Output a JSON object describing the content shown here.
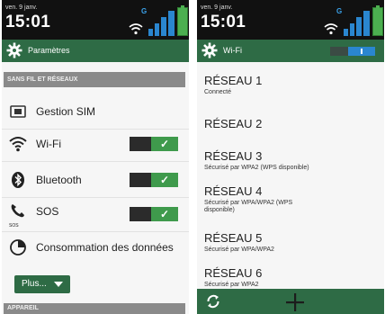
{
  "left": {
    "status": {
      "date": "ven. 9 janv.",
      "time": "15:01",
      "network_type": "G"
    },
    "header": {
      "title": "Paramètres"
    },
    "section_wireless": "SANS FIL ET RÉSEAUX",
    "items": [
      {
        "label": "Gestion SIM",
        "icon": "sim-card-icon"
      },
      {
        "label": "Wi-Fi",
        "icon": "wifi-icon",
        "toggle": true
      },
      {
        "label": "Bluetooth",
        "icon": "bluetooth-icon",
        "toggle": true
      },
      {
        "label": "SOS",
        "icon": "sos-phone-icon",
        "toggle": true,
        "sub": "SOS"
      },
      {
        "label": "Consommation des données",
        "icon": "data-usage-icon"
      }
    ],
    "more_button": "Plus...",
    "section_device": "APPAREIL"
  },
  "right": {
    "status": {
      "date": "ven. 9 janv.",
      "time": "15:01",
      "network_type": "G"
    },
    "header": {
      "title": "Wi-Fi",
      "toggle": true
    },
    "networks": [
      {
        "name": "RÉSEAU 1",
        "status": "Connecté"
      },
      {
        "name": "RÉSEAU 2",
        "status": ""
      },
      {
        "name": "RÉSEAU 3",
        "status": "Sécurisé par WPA2 (WPS disponible)"
      },
      {
        "name": "RÉSEAU 4",
        "status": "Sécurisé par WPA/WPA2 (WPS disponible)"
      },
      {
        "name": "RÉSEAU 5",
        "status": "Sécurisé par WPA/WPA2"
      },
      {
        "name": "RÉSEAU 6",
        "status": "Sécurisé par WPA2"
      }
    ]
  },
  "colors": {
    "header_green": "#2e6b45",
    "toggle_green": "#3f9a4c",
    "toggle_blue": "#2a86cf"
  }
}
